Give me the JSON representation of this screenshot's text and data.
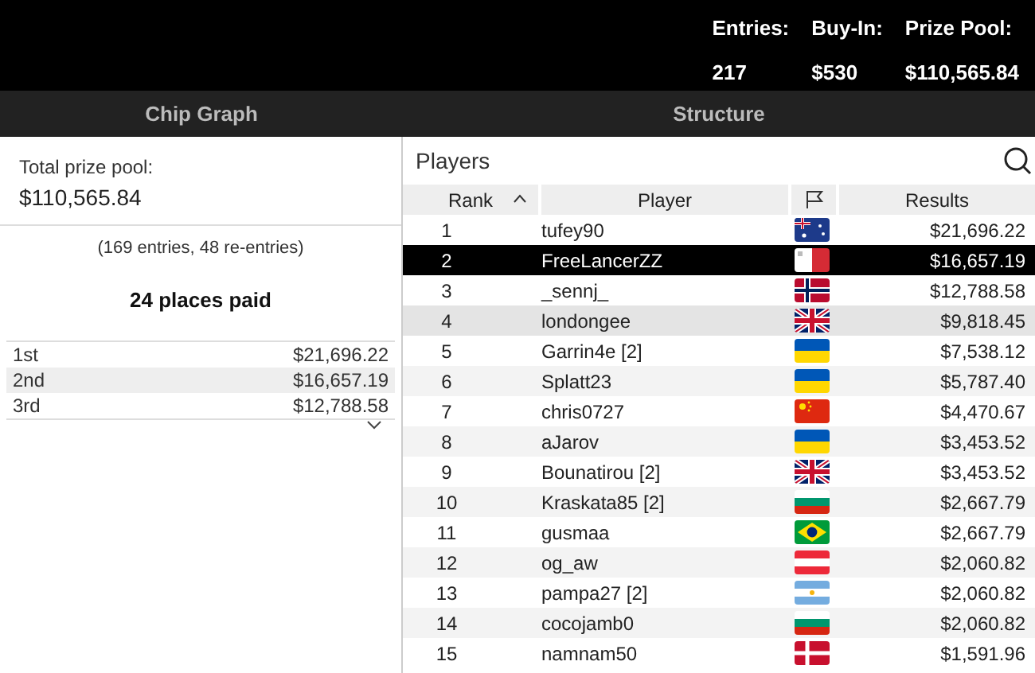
{
  "header": {
    "stats": [
      {
        "label": "Entries:",
        "value": "217"
      },
      {
        "label": "Buy-In:",
        "value": "$530"
      },
      {
        "label": "Prize Pool:",
        "value": "$110,565.84"
      }
    ]
  },
  "tabs": [
    {
      "label": "Chip Graph",
      "selected": false
    },
    {
      "label": "Structure",
      "selected": false
    }
  ],
  "prize_panel": {
    "label": "Total prize pool:",
    "amount": "$110,565.84",
    "entries_note": "(169 entries, 48 re-entries)",
    "places_paid": "24 places paid",
    "payouts": [
      {
        "place": "1st",
        "amount": "$21,696.22"
      },
      {
        "place": "2nd",
        "amount": "$16,657.19"
      },
      {
        "place": "3rd",
        "amount": "$12,788.58"
      }
    ]
  },
  "players": {
    "title": "Players",
    "columns": [
      "Rank",
      "Player",
      "Results"
    ],
    "rows": [
      {
        "rank": "1",
        "player": "tufey90",
        "flag": {
          "kind": "au"
        },
        "result": "$21,696.22",
        "selected": false
      },
      {
        "rank": "2",
        "player": "FreeLancerZZ",
        "flag": {
          "kind": "mt"
        },
        "result": "$16,657.19",
        "selected": true
      },
      {
        "rank": "3",
        "player": "_sennj_",
        "flag": {
          "kind": "no"
        },
        "result": "$12,788.58",
        "selected": false
      },
      {
        "rank": "4",
        "player": "londongee",
        "flag": {
          "kind": "gb"
        },
        "result": "$9,818.45",
        "selected": false,
        "hovered": true
      },
      {
        "rank": "5",
        "player": "Garrin4e [2]",
        "flag": {
          "kind": "ua"
        },
        "result": "$7,538.12",
        "selected": false
      },
      {
        "rank": "6",
        "player": "Splatt23",
        "flag": {
          "kind": "ua"
        },
        "result": "$5,787.40",
        "selected": false
      },
      {
        "rank": "7",
        "player": "chris0727",
        "flag": {
          "kind": "cn"
        },
        "result": "$4,470.67",
        "selected": false
      },
      {
        "rank": "8",
        "player": "aJarov",
        "flag": {
          "kind": "ua"
        },
        "result": "$3,453.52",
        "selected": false
      },
      {
        "rank": "9",
        "player": "Bounatirou [2]",
        "flag": {
          "kind": "gb"
        },
        "result": "$3,453.52",
        "selected": false
      },
      {
        "rank": "10",
        "player": "Kraskata85 [2]",
        "flag": {
          "kind": "bg"
        },
        "result": "$2,667.79",
        "selected": false
      },
      {
        "rank": "11",
        "player": "gusmaa",
        "flag": {
          "kind": "br"
        },
        "result": "$2,667.79",
        "selected": false
      },
      {
        "rank": "12",
        "player": "og_aw",
        "flag": {
          "kind": "at"
        },
        "result": "$2,060.82",
        "selected": false
      },
      {
        "rank": "13",
        "player": "pampa27 [2]",
        "flag": {
          "kind": "ar"
        },
        "result": "$2,060.82",
        "selected": false
      },
      {
        "rank": "14",
        "player": "cocojamb0",
        "flag": {
          "kind": "bg"
        },
        "result": "$2,060.82",
        "selected": false
      },
      {
        "rank": "15",
        "player": "namnam50",
        "flag": {
          "kind": "dk"
        },
        "result": "$1,591.96",
        "selected": false
      }
    ]
  }
}
